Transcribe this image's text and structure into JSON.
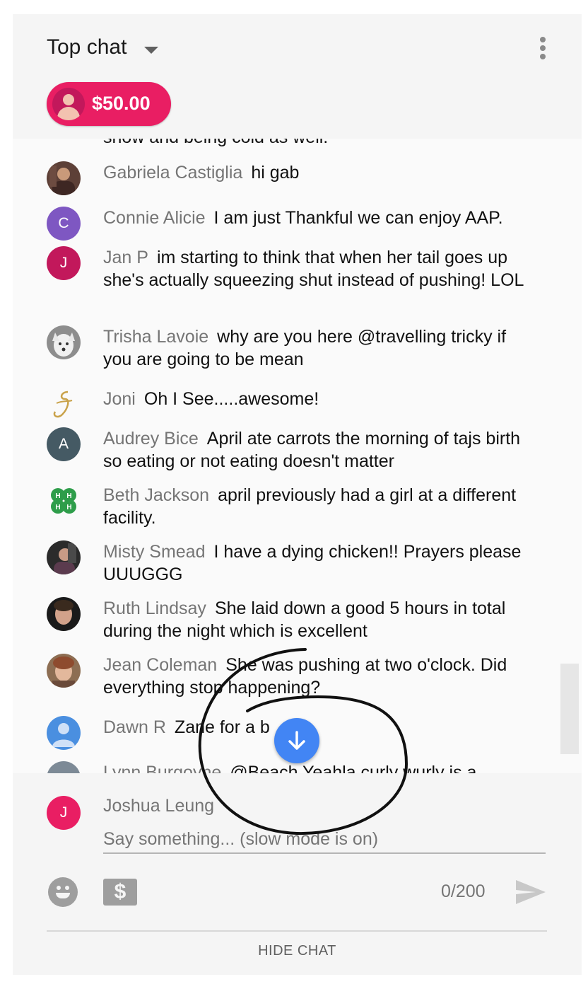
{
  "header": {
    "title": "Top chat",
    "donation": {
      "amount": "$50.00",
      "color": "#e91e63"
    }
  },
  "messages": {
    "partial_text": "snow and being cold as well.",
    "items": [
      {
        "author": "Gabriela Castiglia",
        "text": "hi gab",
        "avatar": "photo"
      },
      {
        "author": "Connie Alicie",
        "text": "I am just Thankful we can enjoy AAP.",
        "avatar": "letter",
        "initial": "C",
        "color": "#7e57c2"
      },
      {
        "author": "Jan P",
        "text": "im starting to think that when her tail goes up she's actually squeezing shut instead of pushing! LOL",
        "avatar": "letter",
        "initial": "J",
        "color": "#c2185b"
      },
      {
        "author": "Trisha Lavoie",
        "text": "why are you here @travelling tricky if you are going to be mean",
        "avatar": "photo-wolf"
      },
      {
        "author": "Joni",
        "text": "Oh I See.....awesome!",
        "avatar": "script-J"
      },
      {
        "author": "Audrey Bice",
        "text": "April ate carrots the morning of tajs birth so eating or not eating doesn't matter",
        "avatar": "letter",
        "initial": "A",
        "color": "#455a64"
      },
      {
        "author": "Beth Jackson",
        "text": "april previously had a girl at a different facility.",
        "avatar": "clover"
      },
      {
        "author": "Misty Smead",
        "text": "I have a dying chicken!! Prayers please UUUGGG",
        "avatar": "photo"
      },
      {
        "author": "Ruth Lindsay",
        "text": "She laid down a good 5 hours in total during the night which is excellent",
        "avatar": "photo"
      },
      {
        "author": "Jean Coleman",
        "text": "She was pushing at two o'clock. Did everything stop happening?",
        "avatar": "photo"
      },
      {
        "author": "Dawn R",
        "text": "Zane for a b",
        "avatar": "default-person"
      },
      {
        "author": "Lynn Burgoyne",
        "text": "@Beach Yeahla curly wurly is a",
        "avatar": "default-person"
      }
    ]
  },
  "footer": {
    "user_initial": "J",
    "user_name": "Joshua Leung",
    "placeholder": "Say something... (slow mode is on)",
    "char_count": "0/200",
    "hide_label": "HIDE CHAT"
  },
  "icons": {
    "dropdown": "caret-down-icon",
    "more": "more-vert-icon",
    "emoji": "emoji-icon",
    "superchat": "dollar-icon",
    "send": "send-icon",
    "scroll_down": "arrow-down-icon"
  },
  "colors": {
    "accent_blue": "#4285f4",
    "author_gray": "#757575"
  }
}
